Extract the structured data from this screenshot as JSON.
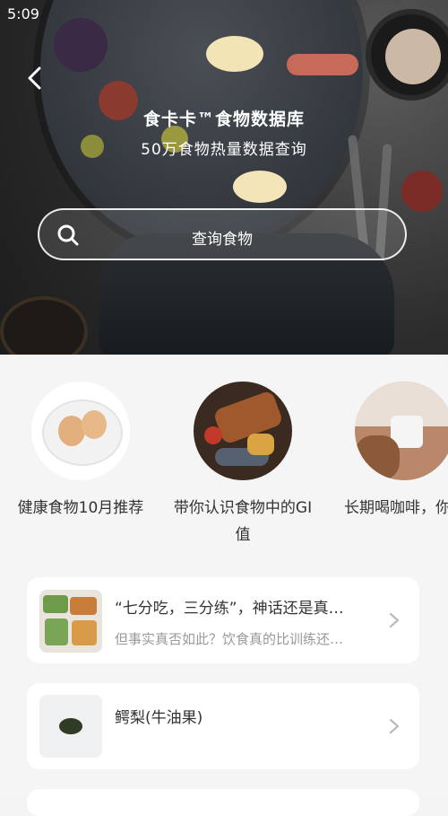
{
  "status_bar": {
    "time": "5:09"
  },
  "header": {
    "title": "食卡卡™食物数据库",
    "subtitle": "50万食物热量数据查询"
  },
  "search": {
    "placeholder": "查询食物"
  },
  "recommendations": [
    {
      "label": "健康食物10月推荐"
    },
    {
      "label": "带你认识食物中的GI值"
    },
    {
      "label": "长期喝咖啡，你的身体会悄悄"
    }
  ],
  "articles": [
    {
      "title": "“七分吃，三分练”，神话还是真…",
      "subtitle": "但事实真否如此？饮食真的比训练还…"
    },
    {
      "title": "鳄梨(牛油果)",
      "subtitle": ""
    }
  ],
  "colors": {
    "accent": "#ffffff",
    "card_bg": "#ffffff",
    "page_bg": "#f5f5f5"
  }
}
